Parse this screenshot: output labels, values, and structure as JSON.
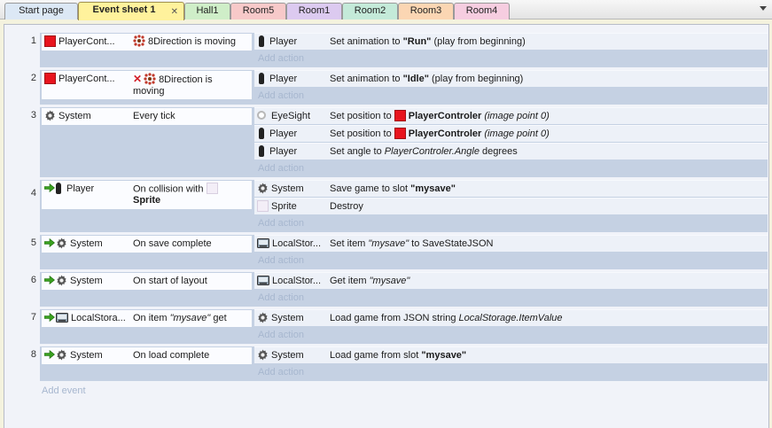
{
  "tabs": [
    {
      "label": "Start page",
      "color": "#dce8f5",
      "active": false
    },
    {
      "label": "Event sheet 1",
      "color": "#fff29c",
      "active": true,
      "close": "✕"
    },
    {
      "label": "Hall1",
      "color": "#cfeec8",
      "active": false
    },
    {
      "label": "Room5",
      "color": "#f7c9c9",
      "active": false
    },
    {
      "label": "Room1",
      "color": "#dccaf0",
      "active": false
    },
    {
      "label": "Room2",
      "color": "#c4ead9",
      "active": false
    },
    {
      "label": "Room3",
      "color": "#fbd6b3",
      "active": false
    },
    {
      "label": "Room4",
      "color": "#f6cde0",
      "active": false
    }
  ],
  "events": [
    {
      "num": "1",
      "cond_obj": "PlayerCont...",
      "cond_text": "8Direction is moving",
      "actions": [
        {
          "obj": "Player",
          "text_pre": "Set animation to ",
          "bold": "\"Run\"",
          "text_post": " (play from beginning)"
        }
      ],
      "add_action": "Add action"
    },
    {
      "num": "2",
      "cond_obj": "PlayerCont...",
      "cond_text": "8Direction is moving",
      "actions": [
        {
          "obj": "Player",
          "text_pre": "Set animation to ",
          "bold": "\"Idle\"",
          "text_post": " (play from beginning)"
        }
      ],
      "add_action": "Add action"
    },
    {
      "num": "3",
      "cond_obj": "System",
      "cond_text": "Every tick",
      "actions": [
        {
          "obj": "EyeSight",
          "text_pre": "Set position to ",
          "bold": "PlayerControler",
          "italic": "(image point 0)"
        },
        {
          "obj": "Player",
          "text_pre": "Set position to ",
          "bold": "PlayerControler",
          "italic": "(image point 0)"
        },
        {
          "obj": "Player",
          "text_pre": "Set angle to ",
          "italic": "PlayerControler.Angle",
          "text_post": " degrees"
        }
      ],
      "add_action": "Add action"
    },
    {
      "num": "4",
      "cond_obj": "Player",
      "cond_text": "On collision with",
      "cond_bold": "Sprite",
      "actions": [
        {
          "obj": "System",
          "text_pre": "Save game to slot ",
          "bold": "\"mysave\""
        },
        {
          "obj": "Sprite",
          "text_pre": "Destroy"
        }
      ],
      "add_action": "Add action"
    },
    {
      "num": "5",
      "cond_obj": "System",
      "cond_text": "On save complete",
      "actions": [
        {
          "obj": "LocalStor...",
          "text_pre": "Set item ",
          "italic": "\"mysave\"",
          "text_post": " to SaveStateJSON"
        }
      ],
      "add_action": "Add action"
    },
    {
      "num": "6",
      "cond_obj": "System",
      "cond_text": "On start of layout",
      "actions": [
        {
          "obj": "LocalStor...",
          "text_pre": "Get item ",
          "italic": "\"mysave\""
        }
      ],
      "add_action": "Add action"
    },
    {
      "num": "7",
      "cond_obj": "LocalStora...",
      "cond_text_pre": "On item ",
      "cond_italic": "\"mysave\"",
      "cond_text_post": " get",
      "actions": [
        {
          "obj": "System",
          "text_pre": "Load game from JSON string ",
          "italic": "LocalStorage.ItemValue"
        }
      ],
      "add_action": "Add action"
    },
    {
      "num": "8",
      "cond_obj": "System",
      "cond_text": "On load complete",
      "actions": [
        {
          "obj": "System",
          "text_pre": "Load game from slot ",
          "bold": "\"mysave\""
        }
      ],
      "add_action": "Add action"
    }
  ],
  "add_event": "Add event"
}
